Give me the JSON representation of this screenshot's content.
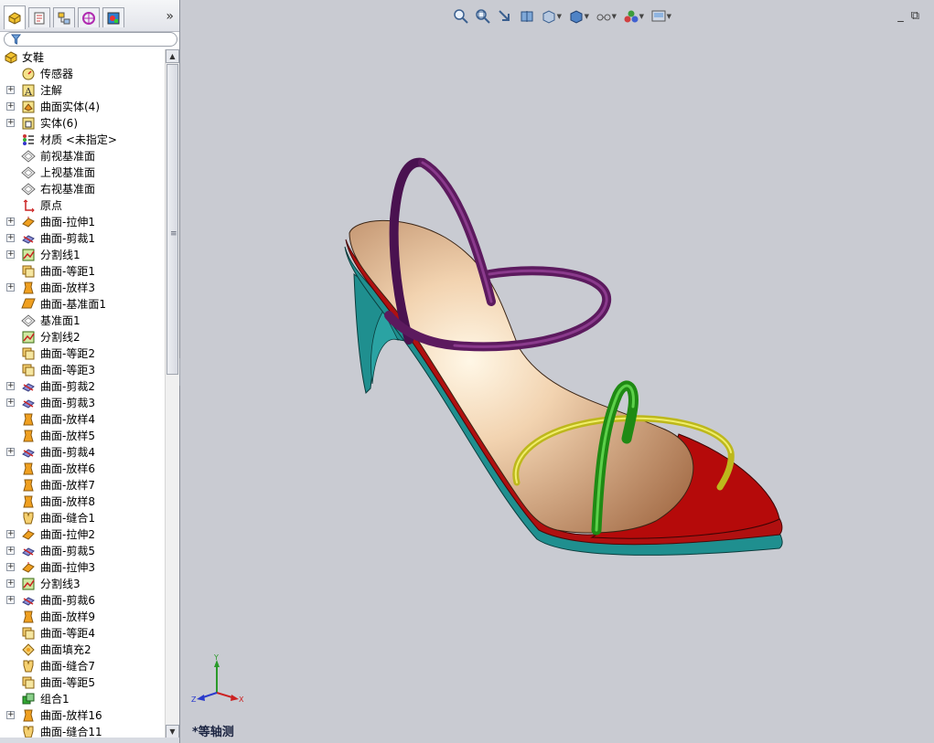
{
  "feature_tree": {
    "root": "女鞋",
    "items": [
      {
        "label": "传感器",
        "icon": "sensor-icon",
        "expandable": false
      },
      {
        "label": "注解",
        "icon": "annotation-icon",
        "expandable": true
      },
      {
        "label": "曲面实体(4)",
        "icon": "surface-bodies-icon",
        "expandable": true
      },
      {
        "label": "实体(6)",
        "icon": "solid-bodies-icon",
        "expandable": true
      },
      {
        "label": "材质 <未指定>",
        "icon": "material-icon",
        "expandable": false
      },
      {
        "label": "前视基准面",
        "icon": "plane-icon",
        "expandable": false
      },
      {
        "label": "上视基准面",
        "icon": "plane-icon",
        "expandable": false
      },
      {
        "label": "右视基准面",
        "icon": "plane-icon",
        "expandable": false
      },
      {
        "label": "原点",
        "icon": "origin-icon",
        "expandable": false
      },
      {
        "label": "曲面-拉伸1",
        "icon": "surface-extrude-icon",
        "expandable": true
      },
      {
        "label": "曲面-剪裁1",
        "icon": "surface-trim-icon",
        "expandable": true
      },
      {
        "label": "分割线1",
        "icon": "split-line-icon",
        "expandable": true
      },
      {
        "label": "曲面-等距1",
        "icon": "surface-offset-icon",
        "expandable": false
      },
      {
        "label": "曲面-放样3",
        "icon": "surface-loft-icon",
        "expandable": true
      },
      {
        "label": "曲面-基准面1",
        "icon": "planar-surface-icon",
        "expandable": false
      },
      {
        "label": "基准面1",
        "icon": "plane-icon",
        "expandable": false
      },
      {
        "label": "分割线2",
        "icon": "split-line-icon",
        "expandable": false
      },
      {
        "label": "曲面-等距2",
        "icon": "surface-offset-icon",
        "expandable": false
      },
      {
        "label": "曲面-等距3",
        "icon": "surface-offset-icon",
        "expandable": false
      },
      {
        "label": "曲面-剪裁2",
        "icon": "surface-trim-icon",
        "expandable": true
      },
      {
        "label": "曲面-剪裁3",
        "icon": "surface-trim-icon",
        "expandable": true
      },
      {
        "label": "曲面-放样4",
        "icon": "surface-loft-icon",
        "expandable": false
      },
      {
        "label": "曲面-放样5",
        "icon": "surface-loft-icon",
        "expandable": false
      },
      {
        "label": "曲面-剪裁4",
        "icon": "surface-trim-icon",
        "expandable": true
      },
      {
        "label": "曲面-放样6",
        "icon": "surface-loft-icon",
        "expandable": false
      },
      {
        "label": "曲面-放样7",
        "icon": "surface-loft-icon",
        "expandable": false
      },
      {
        "label": "曲面-放样8",
        "icon": "surface-loft-icon",
        "expandable": false
      },
      {
        "label": "曲面-缝合1",
        "icon": "surface-knit-icon",
        "expandable": false
      },
      {
        "label": "曲面-拉伸2",
        "icon": "surface-extrude-icon",
        "expandable": true
      },
      {
        "label": "曲面-剪裁5",
        "icon": "surface-trim-icon",
        "expandable": true
      },
      {
        "label": "曲面-拉伸3",
        "icon": "surface-extrude-icon",
        "expandable": true
      },
      {
        "label": "分割线3",
        "icon": "split-line-icon",
        "expandable": true
      },
      {
        "label": "曲面-剪裁6",
        "icon": "surface-trim-icon",
        "expandable": true
      },
      {
        "label": "曲面-放样9",
        "icon": "surface-loft-icon",
        "expandable": false
      },
      {
        "label": "曲面-等距4",
        "icon": "surface-offset-icon",
        "expandable": false
      },
      {
        "label": "曲面填充2",
        "icon": "fill-surface-icon",
        "expandable": false
      },
      {
        "label": "曲面-缝合7",
        "icon": "surface-knit-icon",
        "expandable": false
      },
      {
        "label": "曲面-等距5",
        "icon": "surface-offset-icon",
        "expandable": false
      },
      {
        "label": "组合1",
        "icon": "combine-icon",
        "expandable": false
      },
      {
        "label": "曲面-放样16",
        "icon": "surface-loft-icon",
        "expandable": true
      },
      {
        "label": "曲面-缝合11",
        "icon": "surface-knit-icon",
        "expandable": false
      }
    ]
  },
  "panel_tabs": [
    "feature-manager-icon",
    "property-manager-icon",
    "configuration-manager-icon",
    "dimxpert-icon",
    "display-manager-icon"
  ],
  "viewport": {
    "view_name": "*等轴测",
    "triad_labels": {
      "x": "X",
      "y": "Y",
      "z": "Z"
    }
  },
  "colors": {
    "viewport_bg": "#c9cbd2",
    "sole": "#1f8f8f",
    "outsole_front": "#b01010",
    "insole": "#c89068",
    "strap_back": "#5c1a5e",
    "strap_green": "#2fa51f",
    "strap_yellow": "#d6d230"
  }
}
